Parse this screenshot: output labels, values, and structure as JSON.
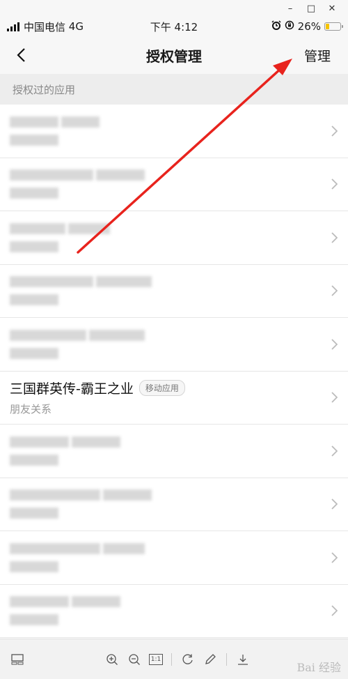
{
  "window": {
    "minimize": "–",
    "maximize": "□",
    "close": "✕"
  },
  "status_bar": {
    "carrier": "中国电信",
    "network": "4G",
    "time": "下午 4:12",
    "battery_percent": "26%",
    "battery_level": 0.26,
    "icons": [
      "signal-icon",
      "alarm-icon",
      "lock-rotation-icon",
      "battery-icon"
    ]
  },
  "nav": {
    "title": "授权管理",
    "manage_label": "管理",
    "back_icon": "chevron-left-icon"
  },
  "section": {
    "title": "授权过的应用"
  },
  "list": {
    "clear_item": {
      "name": "三国群英传-霸王之业",
      "tag": "移动应用",
      "subtitle": "朋友关系"
    }
  },
  "viewer": {
    "icons": [
      "thumbnail-icon",
      "zoom-in-icon",
      "zoom-out-icon",
      "actual-size-icon",
      "rotate-icon",
      "edit-icon",
      "download-icon"
    ],
    "actual_size_label": "1:1",
    "watermark": "Bai 经验"
  },
  "colors": {
    "annotation_arrow": "#e8231d",
    "battery_fill": "#f5c400"
  }
}
